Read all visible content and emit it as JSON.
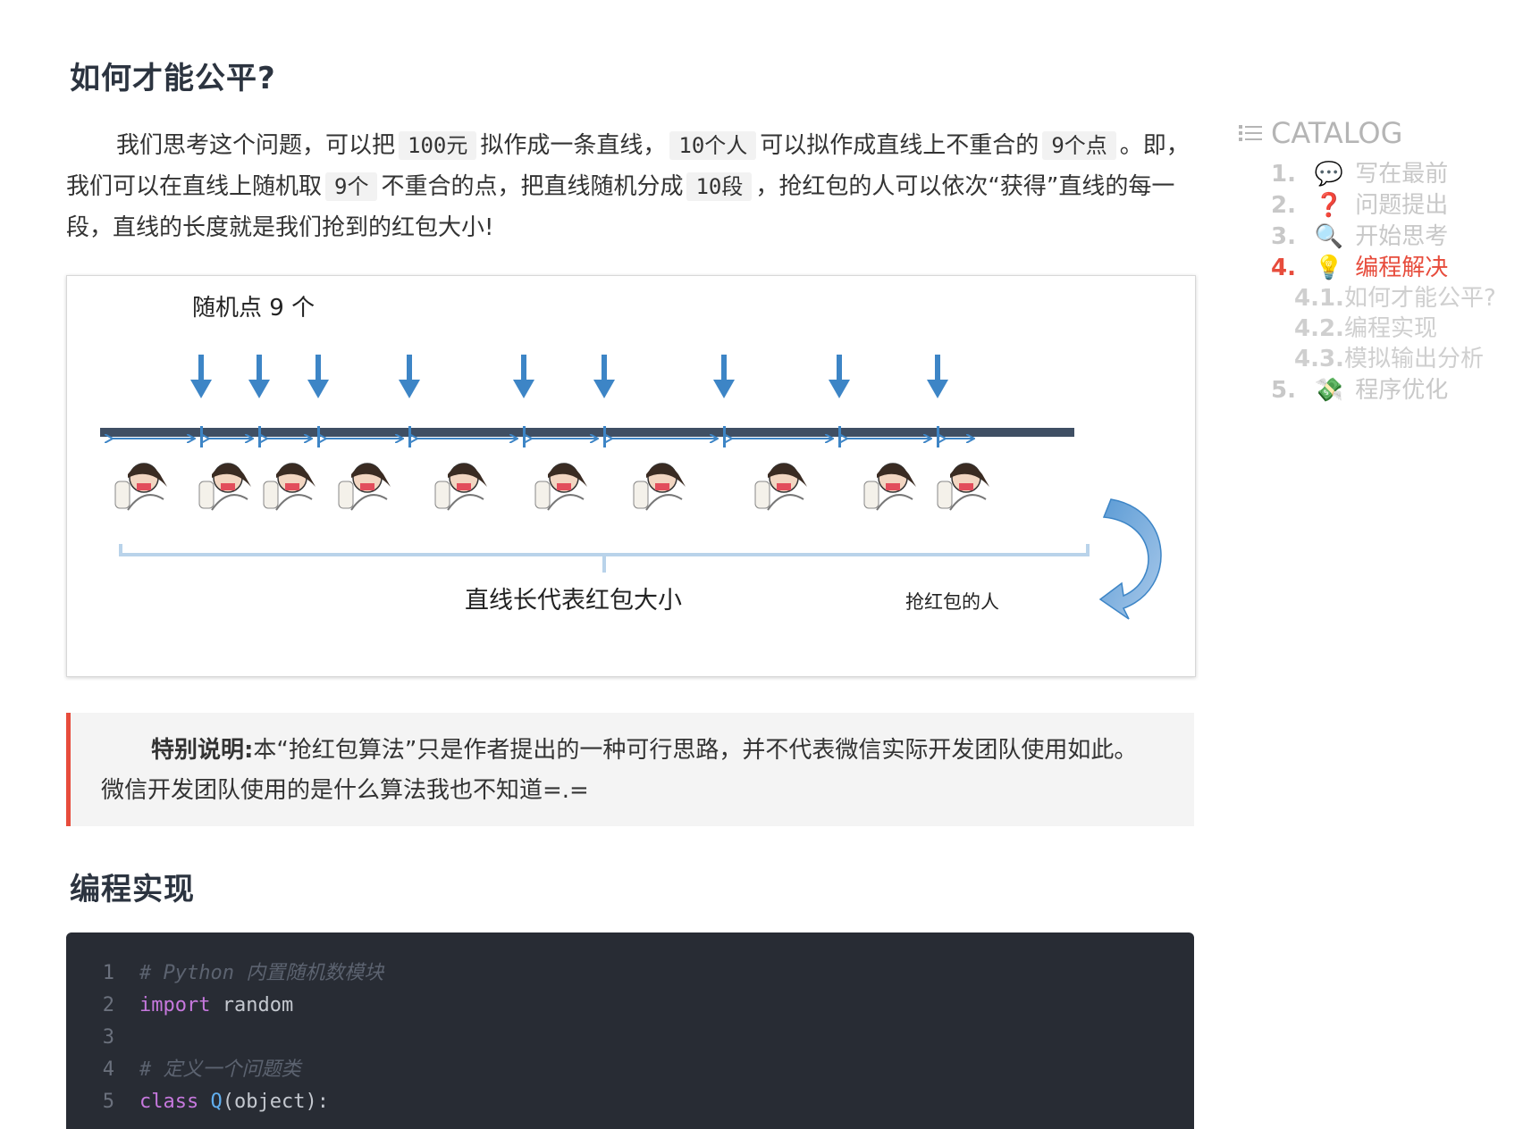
{
  "section1": {
    "title": "如何才能公平?",
    "para": {
      "t1": "我们思考这个问题，可以把",
      "c1": "100元",
      "t2": "拟作成一条直线，",
      "c2": "10个人",
      "t3": "可以拟作成直线上不重合的",
      "c3": "9个点",
      "t4": "。即，我们可以在直线上随机取",
      "c4": "9个",
      "t5": "不重合的点，把直线随机分成",
      "c5": "10段",
      "t6": "，抢红包的人可以依次“获得”直线的每一段，直线的长度就是我们抢到的红包大小!"
    }
  },
  "figure": {
    "top_label": "随机点 9 个",
    "bottom_label": "直线长代表红包大小",
    "right_label": "抢红包的人",
    "point_count": 9,
    "segment_count": 10,
    "colors": {
      "arrow": "#3d85c6",
      "line": "#3f4f64",
      "bracket": "#b9d3ea"
    }
  },
  "note": {
    "label": "特别说明:",
    "text": "本“抢红包算法”只是作者提出的一种可行思路，并不代表微信实际开发团队使用如此。微信开发团队使用的是什么算法我也不知道=.="
  },
  "section2": {
    "title": "编程实现"
  },
  "code": {
    "lines": [
      {
        "n": "1",
        "comment": "# Python 内置随机数模块"
      },
      {
        "n": "2",
        "kw": "import",
        "rest": " random"
      },
      {
        "n": "3"
      },
      {
        "n": "4",
        "comment": "# 定义一个问题类"
      },
      {
        "n": "5",
        "kw": "class",
        "cls": " Q",
        "rest": "(object):"
      }
    ]
  },
  "catalog": {
    "title": "CATALOG",
    "items": [
      {
        "num": "1.",
        "emoji": "💬",
        "label": "写在最前"
      },
      {
        "num": "2.",
        "emoji": "❓",
        "label": "问题提出"
      },
      {
        "num": "3.",
        "emoji": "🔍",
        "label": "开始思考"
      },
      {
        "num": "4.",
        "emoji": "💡",
        "label": "编程解决"
      },
      {
        "num": "4.1.",
        "label": "如何才能公平?"
      },
      {
        "num": "4.2.",
        "label": "编程实现"
      },
      {
        "num": "4.3.",
        "label": "模拟输出分析"
      },
      {
        "num": "5.",
        "emoji": "💸",
        "label": "程序优化"
      }
    ],
    "active_color": "#e74c3c"
  }
}
